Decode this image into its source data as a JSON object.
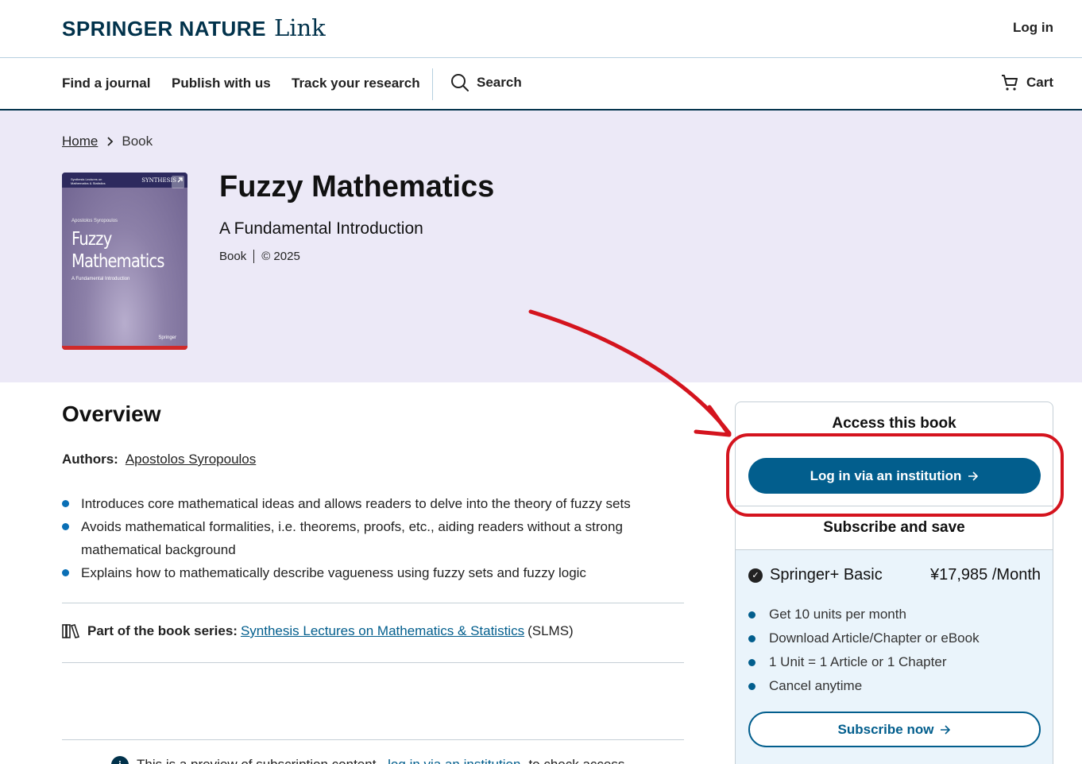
{
  "header": {
    "brand": "SPRINGER NATURE",
    "brand_link": "Link",
    "login": "Log in"
  },
  "nav": {
    "find_journal": "Find a journal",
    "publish": "Publish with us",
    "track": "Track your research",
    "search": "Search",
    "cart": "Cart"
  },
  "breadcrumb": {
    "home": "Home",
    "current": "Book"
  },
  "cover": {
    "series": "Synthesis Lectures on Mathematics & Statistics",
    "publisher_series": "SYNTHESIS",
    "author": "Apostolos Syropoulos",
    "title": "Fuzzy Mathematics",
    "subtitle": "A Fundamental Introduction",
    "publisher": "Springer"
  },
  "book": {
    "title": "Fuzzy Mathematics",
    "subtitle": "A Fundamental Introduction",
    "type": "Book",
    "year": "© 2025"
  },
  "overview": {
    "heading": "Overview",
    "authors_label": "Authors:",
    "author": "Apostolos Syropoulos",
    "bullets": [
      "Introduces core mathematical ideas and allows readers to delve into the theory of fuzzy sets",
      "Avoids mathematical formalities, i.e. theorems, proofs, etc., aiding readers without a strong mathematical background",
      "Explains how to mathematically describe vagueness using fuzzy sets and fuzzy logic"
    ],
    "series_label": "Part of the book series:",
    "series_link": "Synthesis Lectures on Mathematics & Statistics",
    "series_abbr": "(SLMS)",
    "preview_text": "This is a preview of subscription content,",
    "preview_link": "log in via an institution",
    "preview_tail": "to check access."
  },
  "access": {
    "heading": "Access this book",
    "institution_button": "Log in via an institution",
    "subscribe_heading": "Subscribe and save",
    "plan_name": "Springer+ Basic",
    "plan_price": "¥17,985 /Month",
    "plan_features": [
      "Get 10 units per month",
      "Download Article/Chapter or eBook",
      "1 Unit = 1 Article or 1 Chapter",
      "Cancel anytime"
    ],
    "subscribe_button": "Subscribe now"
  },
  "colors": {
    "brand_dark": "#01324b",
    "link_blue": "#025e8d",
    "hero_bg": "#ece9f7",
    "annotation_red": "#d4141e"
  },
  "icons": [
    "search-icon",
    "cart-icon",
    "chevron-right-icon",
    "arrow-right-icon",
    "books-icon",
    "check-circle-icon",
    "info-icon",
    "expand-icon"
  ]
}
